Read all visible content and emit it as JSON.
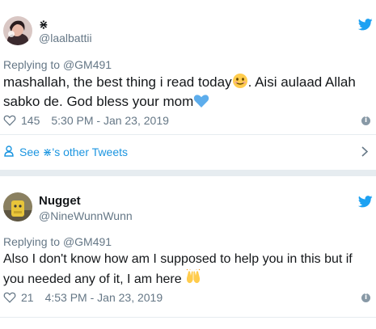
{
  "tweet1": {
    "name": "⋇",
    "handle": "@laalbattii",
    "replying_prefix": "Replying to ",
    "replying_to": "@GM491",
    "text_line1_a": "mashallah, the best thing i read today",
    "text_line1_b": ". Aisi aulaad Allah",
    "text_line2": "sabko de. God bless your mom",
    "likes": "145",
    "time": "5:30 PM - Jan 23, 2019"
  },
  "see_more": {
    "label": "See ⋇'s other Tweets"
  },
  "tweet2": {
    "name": "Nugget",
    "handle": "@NineWunnWunn",
    "replying_prefix": "Replying to ",
    "replying_to": "@GM491",
    "text_line1": "Also I don't know how am I supposed to help you in this but if",
    "text_line2": "you needed any of it, I am here",
    "likes": "21",
    "time": "4:53 PM - Jan 23, 2019"
  },
  "colors": {
    "twitter_blue": "#1da1f2",
    "link_blue": "#1b95e0",
    "secondary_text": "#657786",
    "divider": "#e6ecf0"
  }
}
